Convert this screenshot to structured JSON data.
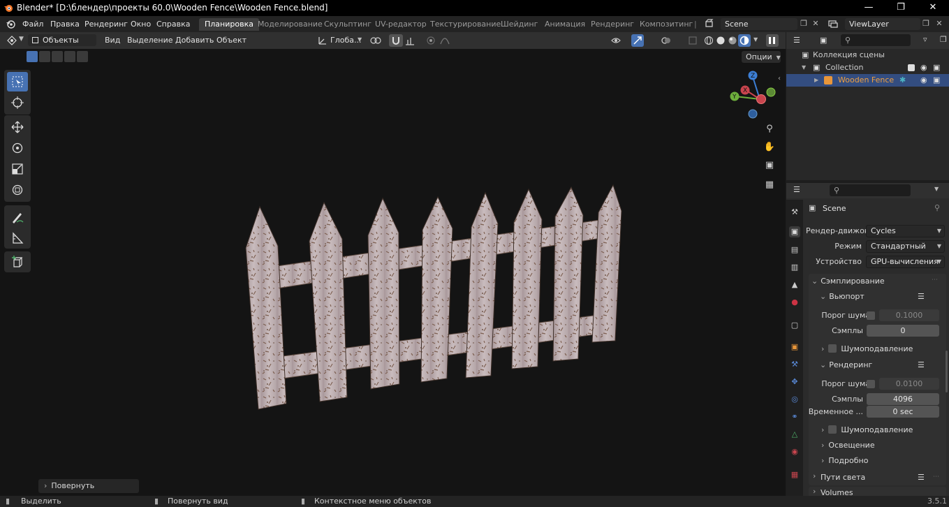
{
  "window": {
    "title": "Blender* [D:\\блендер\\проекты 60.0\\Wooden Fence\\Wooden Fence.blend]"
  },
  "menus": [
    "Файл",
    "Правка",
    "Рендеринг",
    "Окно",
    "Справка"
  ],
  "workspaces": {
    "active": "Планировка",
    "tabs": [
      "Планировка",
      "Моделирование",
      "Скульптинг",
      "UV-редактор",
      "Текстурирование",
      "Шейдинг",
      "Анимация",
      "Рендеринг",
      "Композитинг"
    ]
  },
  "scene_name": "Scene",
  "view_layer": "ViewLayer",
  "viewport_header": {
    "mode": "Объекты",
    "menus": [
      "Вид",
      "Выделение",
      "Добавить",
      "Объект"
    ],
    "orientation": "Глоба..."
  },
  "options_label": "Опции",
  "gizmo_axes": {
    "x": "X",
    "y": "Y",
    "z": "Z"
  },
  "last_operator": "Повернуть",
  "outliner": {
    "scene_collection": "Коллекция сцены",
    "collection": "Collection",
    "object": "Wooden Fence"
  },
  "properties": {
    "context": "Scene",
    "render_engine_label": "Рендер-движок",
    "render_engine": "Cycles",
    "mode_label": "Режим",
    "mode": "Стандартный",
    "device_label": "Устройство",
    "device": "GPU-вычисления",
    "sampling": "Сэмплирование",
    "viewport": "Вьюпорт",
    "noise_threshold_label": "Порог шума",
    "viewport_noise_threshold": "0.1000",
    "samples_label": "Сэмплы",
    "viewport_samples": "0",
    "denoise": "Шумоподавление",
    "render": "Рендеринг",
    "render_noise_threshold": "0.0100",
    "render_samples": "4096",
    "time_limit_label": "Временное ...",
    "time_limit": "0 sec",
    "denoise2": "Шумоподавление",
    "lighting": "Освещение",
    "advanced": "Подробно",
    "light_paths": "Пути света",
    "volumes": "Volumes"
  },
  "statusbar": {
    "select": "Выделить",
    "rotate_view": "Повернуть вид",
    "context_menu": "Контекстное меню объектов",
    "version": "3.5.1"
  }
}
